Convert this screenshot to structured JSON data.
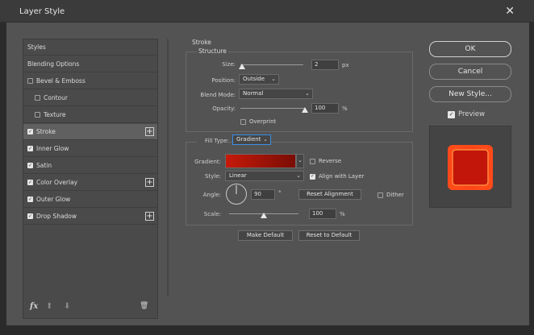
{
  "window": {
    "title": "Layer Style",
    "close_glyph": "✕"
  },
  "sidebar": {
    "items": [
      {
        "label": "Styles",
        "checkbox": false
      },
      {
        "label": "Blending Options",
        "checkbox": false
      },
      {
        "label": "Bevel & Emboss",
        "checkbox": true,
        "checked": false
      },
      {
        "label": "Contour",
        "checkbox": true,
        "checked": false
      },
      {
        "label": "Texture",
        "checkbox": true,
        "checked": false
      },
      {
        "label": "Stroke",
        "checkbox": true,
        "checked": true,
        "plus": true
      },
      {
        "label": "Inner Glow",
        "checkbox": true,
        "checked": true
      },
      {
        "label": "Satin",
        "checkbox": true,
        "checked": true
      },
      {
        "label": "Color Overlay",
        "checkbox": true,
        "checked": true,
        "plus": true
      },
      {
        "label": "Outer Glow",
        "checkbox": true,
        "checked": true
      },
      {
        "label": "Drop Shadow",
        "checkbox": true,
        "checked": true,
        "plus": true
      }
    ],
    "footer": {
      "fx": "fx",
      "up": "⬆",
      "down": "⬇",
      "trash": "🗑"
    }
  },
  "stroke": {
    "section_title": "Stroke",
    "structure_title": "Structure",
    "size_label": "Size:",
    "size_value": "2",
    "size_unit": "px",
    "position_label": "Position:",
    "position_value": "Outside",
    "blend_label": "Blend Mode:",
    "blend_value": "Normal",
    "opacity_label": "Opacity:",
    "opacity_value": "100",
    "opacity_unit": "%",
    "overprint_label": "Overprint",
    "overprint_checked": false,
    "filltype_label": "Fill Type:",
    "filltype_value": "Gradient",
    "gradient_label": "Gradient:",
    "reverse_label": "Reverse",
    "reverse_checked": false,
    "style_label": "Style:",
    "style_value": "Linear",
    "align_label": "Align with Layer",
    "align_checked": true,
    "angle_label": "Angle:",
    "angle_value": "90",
    "angle_unit": "°",
    "reset_alignment": "Reset Alignment",
    "dither_label": "Dither",
    "dither_checked": false,
    "scale_label": "Scale:",
    "scale_value": "100",
    "scale_unit": "%",
    "make_default": "Make Default",
    "reset_default": "Reset to Default",
    "size_slider_level": 0.02,
    "opacity_slider_level": 1.0,
    "scale_slider_level": 0.5,
    "gradient_colors": [
      "#c61a0a",
      "#7a0d05"
    ]
  },
  "actions": {
    "ok": "OK",
    "cancel": "Cancel",
    "new_style": "New Style...",
    "preview_label": "Preview",
    "preview_checked": true
  },
  "colors": {
    "panel": "#535353",
    "accent": "#3a8ee6",
    "preview_red": "#e0240f"
  }
}
